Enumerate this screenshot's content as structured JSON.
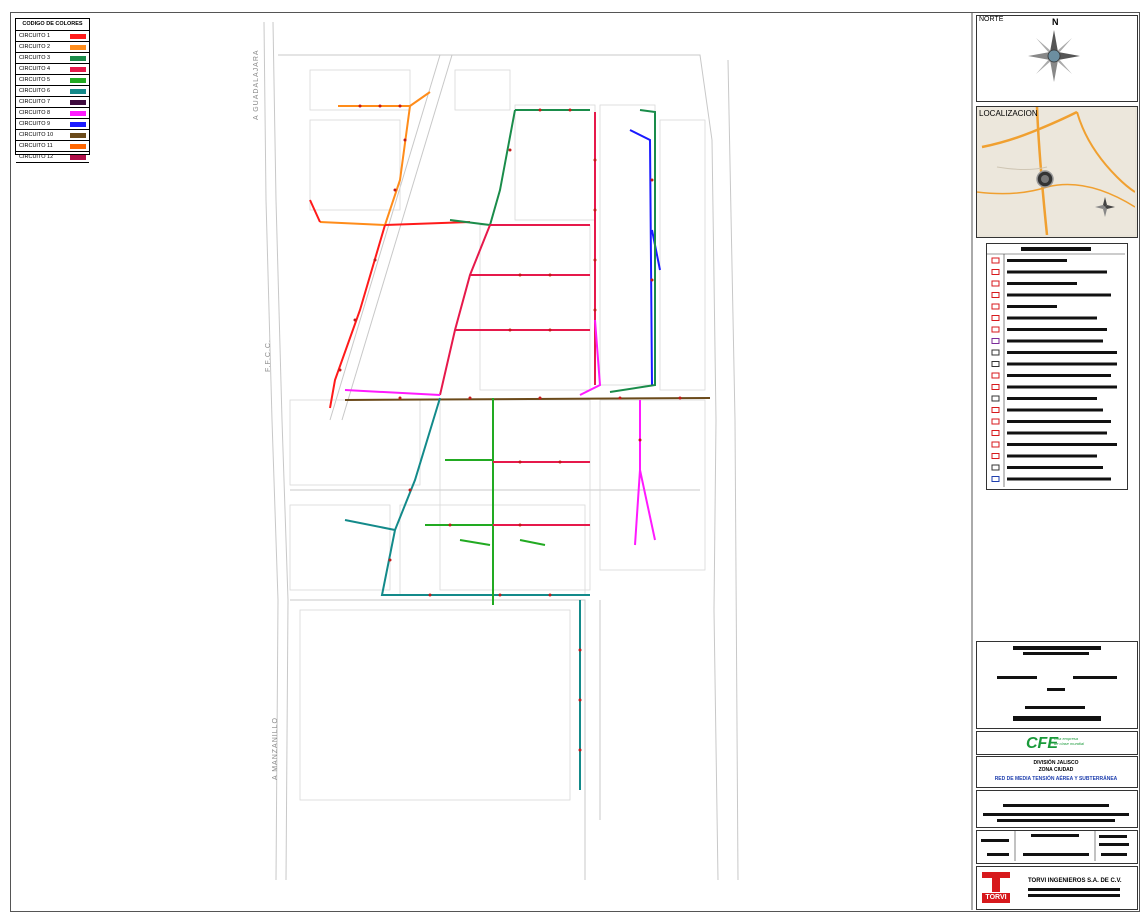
{
  "legend": {
    "title": "CODIGO DE COLORES",
    "items": [
      {
        "label": "CIRCUITO 1",
        "color": "#ff1a1a"
      },
      {
        "label": "CIRCUITO 2",
        "color": "#ff8c1a"
      },
      {
        "label": "CIRCUITO 3",
        "color": "#1a8c4a"
      },
      {
        "label": "CIRCUITO 4",
        "color": "#e6194b"
      },
      {
        "label": "CIRCUITO 5",
        "color": "#22aa22"
      },
      {
        "label": "CIRCUITO 6",
        "color": "#138a8a"
      },
      {
        "label": "CIRCUITO 7",
        "color": "#3d0a3d"
      },
      {
        "label": "CIRCUITO 8",
        "color": "#ff1aff"
      },
      {
        "label": "CIRCUITO 9",
        "color": "#1a1aff"
      },
      {
        "label": "CIRCUITO 10",
        "color": "#6b4a1a"
      },
      {
        "label": "CIRCUITO 11",
        "color": "#ff6600"
      },
      {
        "label": "CIRCUITO 12",
        "color": "#b0104a"
      }
    ]
  },
  "labels": {
    "norte": "NORTE",
    "north_letter": "N",
    "localizacion": "LOCALIZACION",
    "road_top": "A GUADALAJARA",
    "road_left": "F.F.C.C.",
    "road_bottom": "A MANZANILLO",
    "cfe_logo": "CFE",
    "cfe_tagline_1": "Una empresa",
    "cfe_tagline_2": "de clase mundial",
    "division": "DIVISIÓN JALISCO",
    "zona": "ZONA CIUDAD",
    "project": "RED DE MEDIA TENSIÓN AÉREA Y SUBTERRÁNEA",
    "company": "TORVI INGENIEROS S.A. DE C.V.",
    "torvi_logo": "TORVI"
  }
}
